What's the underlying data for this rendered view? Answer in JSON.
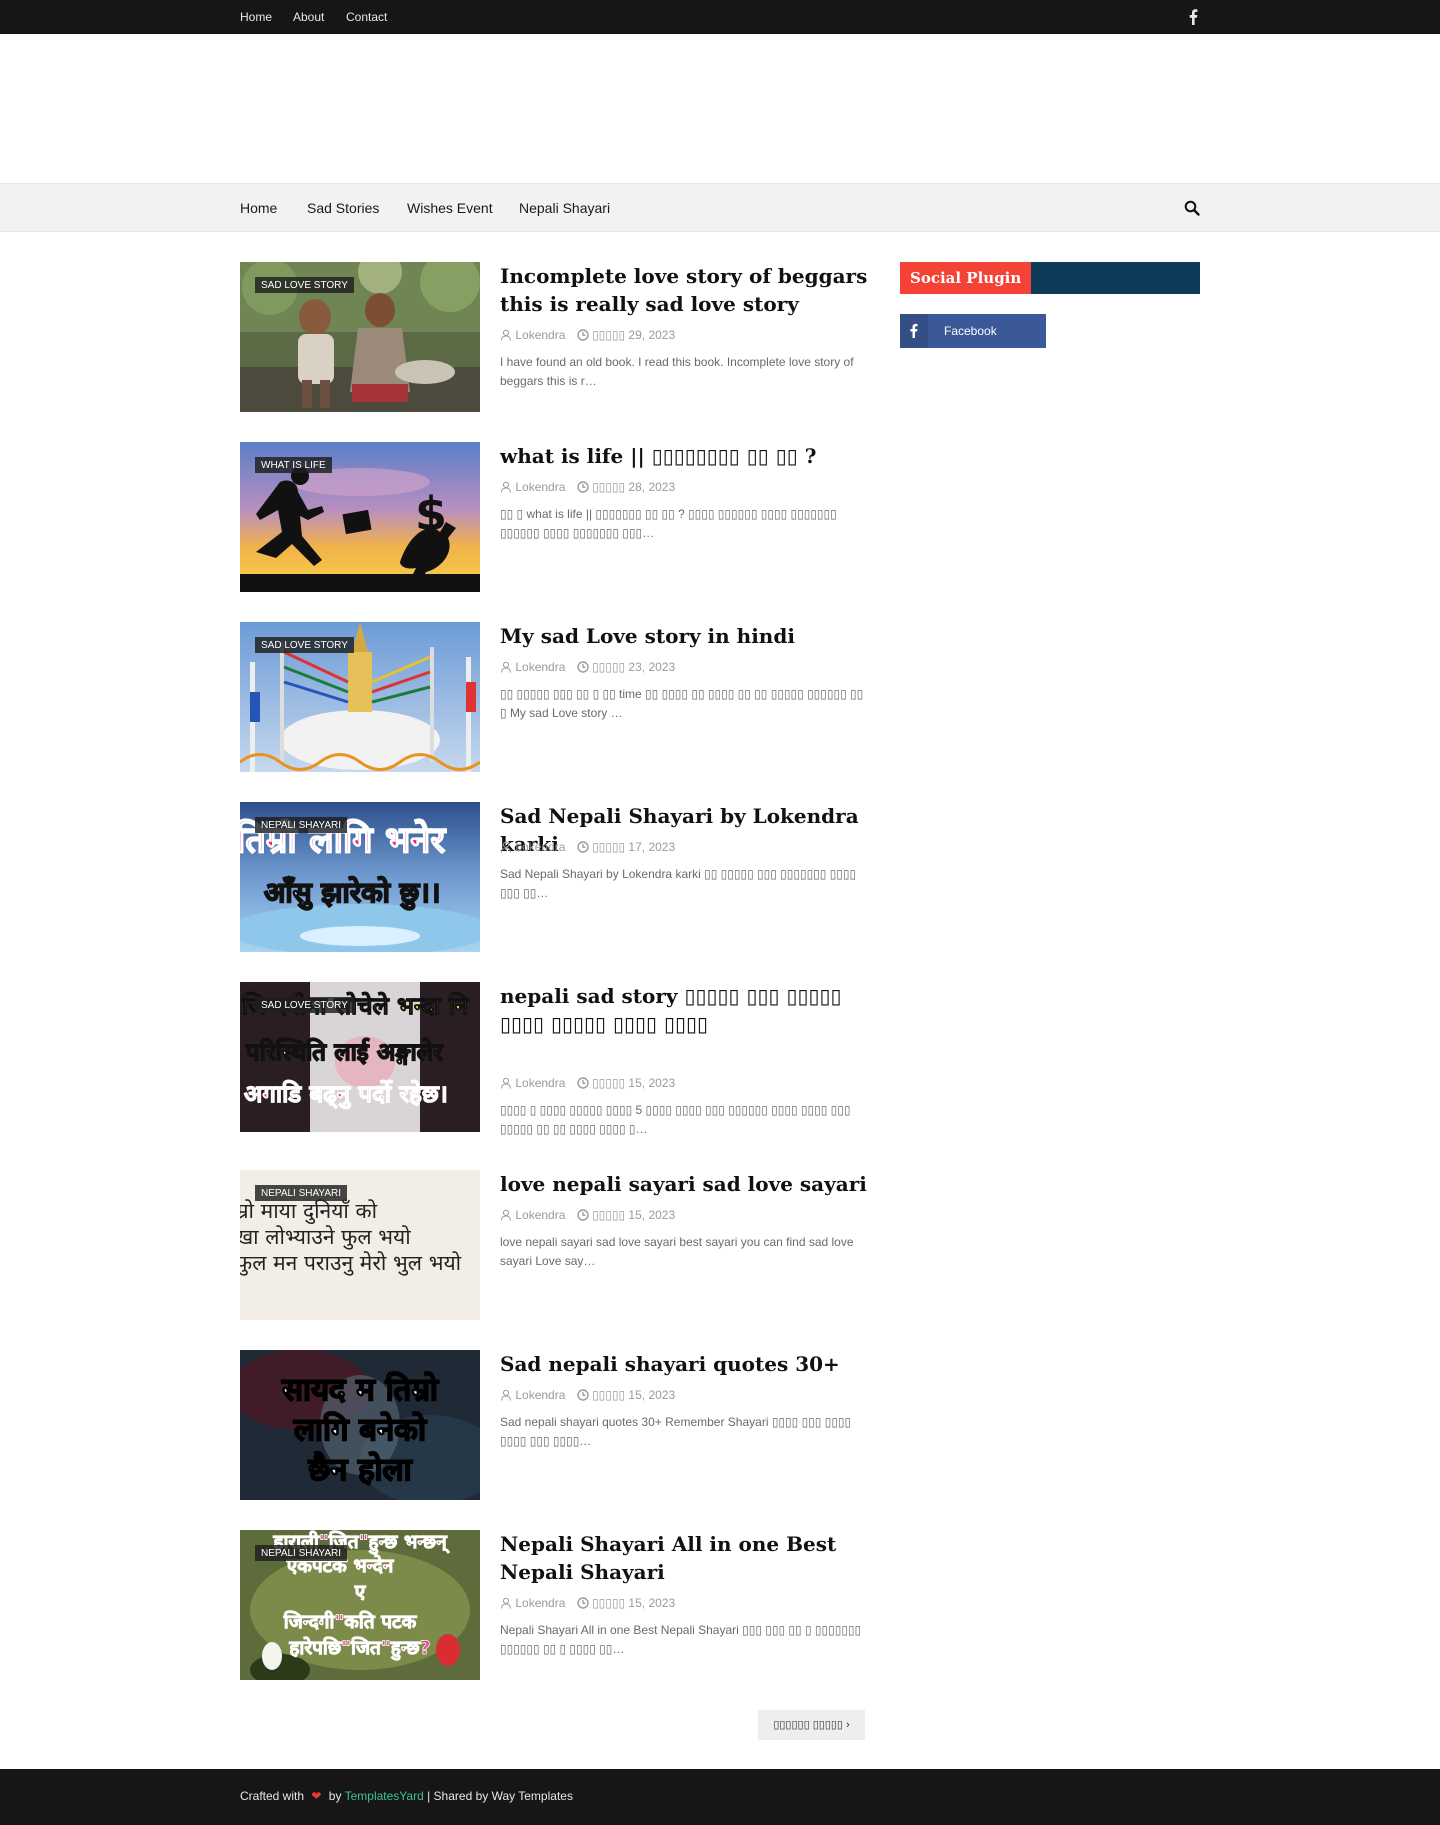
{
  "topbar": {
    "links": [
      "Home",
      "About",
      "Contact"
    ],
    "facebook_icon": "facebook-icon"
  },
  "nav": {
    "items": [
      "Home",
      "Sad Stories",
      "Wishes Event",
      "Nepali Shayari"
    ],
    "search_icon": "search-icon"
  },
  "posts": [
    {
      "label": "SAD LOVE STORY",
      "title": "Incomplete love story of beggars this is really sad love story",
      "author": "Lokendra",
      "date": "▯▯▯▯▯ 29, 2023",
      "excerpt": "I have found an old book. I read this book. Incomplete love story of beggars this is r…"
    },
    {
      "label": "WHAT IS LIFE",
      "title": "what is life || ▯▯▯▯▯▯▯▯ ▯▯ ▯▯ ?",
      "author": "Lokendra",
      "date": "▯▯▯▯▯ 28, 2023",
      "excerpt": "▯▯ ▯ what is life || ▯▯▯▯▯▯▯ ▯▯ ▯▯ ? ▯▯▯▯ ▯▯▯▯▯▯ ▯▯▯▯ ▯▯▯▯▯▯▯ ▯▯▯▯▯▯ ▯▯▯▯ ▯▯▯▯▯▯▯ ▯▯▯…"
    },
    {
      "label": "SAD LOVE STORY",
      "title": "My sad Love story in hindi",
      "author": "Lokendra",
      "date": "▯▯▯▯▯ 23, 2023",
      "excerpt": "▯▯ ▯▯▯▯▯ ▯▯▯ ▯▯ ▯ ▯▯ time ▯▯ ▯▯▯▯ ▯▯ ▯▯▯▯ ▯▯ ▯▯ ▯▯▯▯▯ ▯▯▯▯▯▯ ▯▯ ▯ My sad Love story …"
    },
    {
      "label": "NEPALI SHAYARI",
      "title": "Sad Nepali Shayari by Lokendra karki",
      "author": "Lokendra",
      "date": "▯▯▯▯▯ 17, 2023",
      "excerpt": "Sad Nepali Shayari by Lokendra karki ▯▯ ▯▯▯▯▯ ▯▯▯ ▯▯▯▯▯▯▯ ▯▯▯▯ ▯▯▯ ▯▯…"
    },
    {
      "label": "SAD LOVE STORY",
      "title": "nepali sad story ▯▯▯▯▯ ▯▯▯ ▯▯▯▯▯ ▯▯▯▯ ▯▯▯▯▯ ▯▯▯▯ ▯▯▯▯",
      "author": "Lokendra",
      "date": "▯▯▯▯▯ 15, 2023",
      "excerpt": "▯▯▯▯ ▯ ▯▯▯▯ ▯▯▯▯▯ ▯▯▯▯ 5 ▯▯▯▯ ▯▯▯▯ ▯▯▯ ▯▯▯▯▯▯ ▯▯▯▯ ▯▯▯▯ ▯▯▯ ▯▯▯▯▯ ▯▯ ▯▯ ▯▯▯▯ ▯▯▯▯ ▯…"
    },
    {
      "label": "NEPALI SHAYARI",
      "title": "love nepali sayari sad love sayari",
      "author": "Lokendra",
      "date": "▯▯▯▯▯ 15, 2023",
      "excerpt": "love nepali sayari sad love sayari best sayari you can find sad love sayari Love say…"
    },
    {
      "label": "",
      "title": "Sad nepali shayari quotes 30+",
      "author": "Lokendra",
      "date": "▯▯▯▯▯ 15, 2023",
      "excerpt": "Sad nepali shayari quotes 30+      Remember Shayari    ▯▯▯▯ ▯▯▯ ▯▯▯▯ ▯▯▯▯ ▯▯▯ ▯▯▯▯…"
    },
    {
      "label": "NEPALI SHAYARI",
      "title": "Nepali Shayari All in one Best Nepali Shayari",
      "author": "Lokendra",
      "date": "▯▯▯▯▯ 15, 2023",
      "excerpt": "Nepali Shayari All in one Best Nepali Shayari ▯▯▯ ▯▯▯ ▯▯ ▯ ▯▯▯▯▯▯▯ ▯▯▯▯▯▯ ▯▯ ▯ ▯▯▯▯ ▯▯…"
    }
  ],
  "thumb_texts": {
    "p4_line1": "तिम्रो लागि भनेर",
    "p4_line2": "आँसु झारेको छु।।",
    "p5_line1": "जिन्दगीमा सोचेले भन्दा नि",
    "p5_line2": "परिस्थिति लाई अङ्गालेर",
    "p5_line3": "अगाडि बढ्नु पर्दो रहेछ।",
    "p6_line1": "म्रो माया दुनियाँ को",
    "p6_line2": "खा लोभ्याउने फुल भयो",
    "p6_line3": "फुल मन पराउनु मेरो भुल भयो",
    "p7_line1": "सायद म तिम्रो",
    "p7_line2": "लागि बनेको",
    "p7_line3": "छैन होला",
    "p8_line1": "हाराली\"जित\"हुन्छ भन्छन्",
    "p8_line2": "एकपटक भन्देन",
    "p8_line3": "ए",
    "p8_line4": "जिन्दगी\"कति पटक",
    "p8_line5": "हारेपछि\"जित\"हुन्छ?"
  },
  "sidebar": {
    "title": "Social Plugin",
    "facebook_label": "Facebook"
  },
  "pagination": {
    "older_label": "▯▯▯▯▯▯ ▯▯▯▯▯ ›"
  },
  "footer": {
    "crafted": "Crafted with",
    "heart": "❤",
    "by": "by",
    "brand": "TemplatesYard",
    "shared": "| Shared by Way Templates"
  },
  "colors": {
    "topbar_bg": "#161619",
    "accent_red": "#f44336",
    "sidebar_head_bg": "#0e3b5a",
    "facebook_blue": "#3b5998",
    "brand_green": "#3ec28f"
  }
}
